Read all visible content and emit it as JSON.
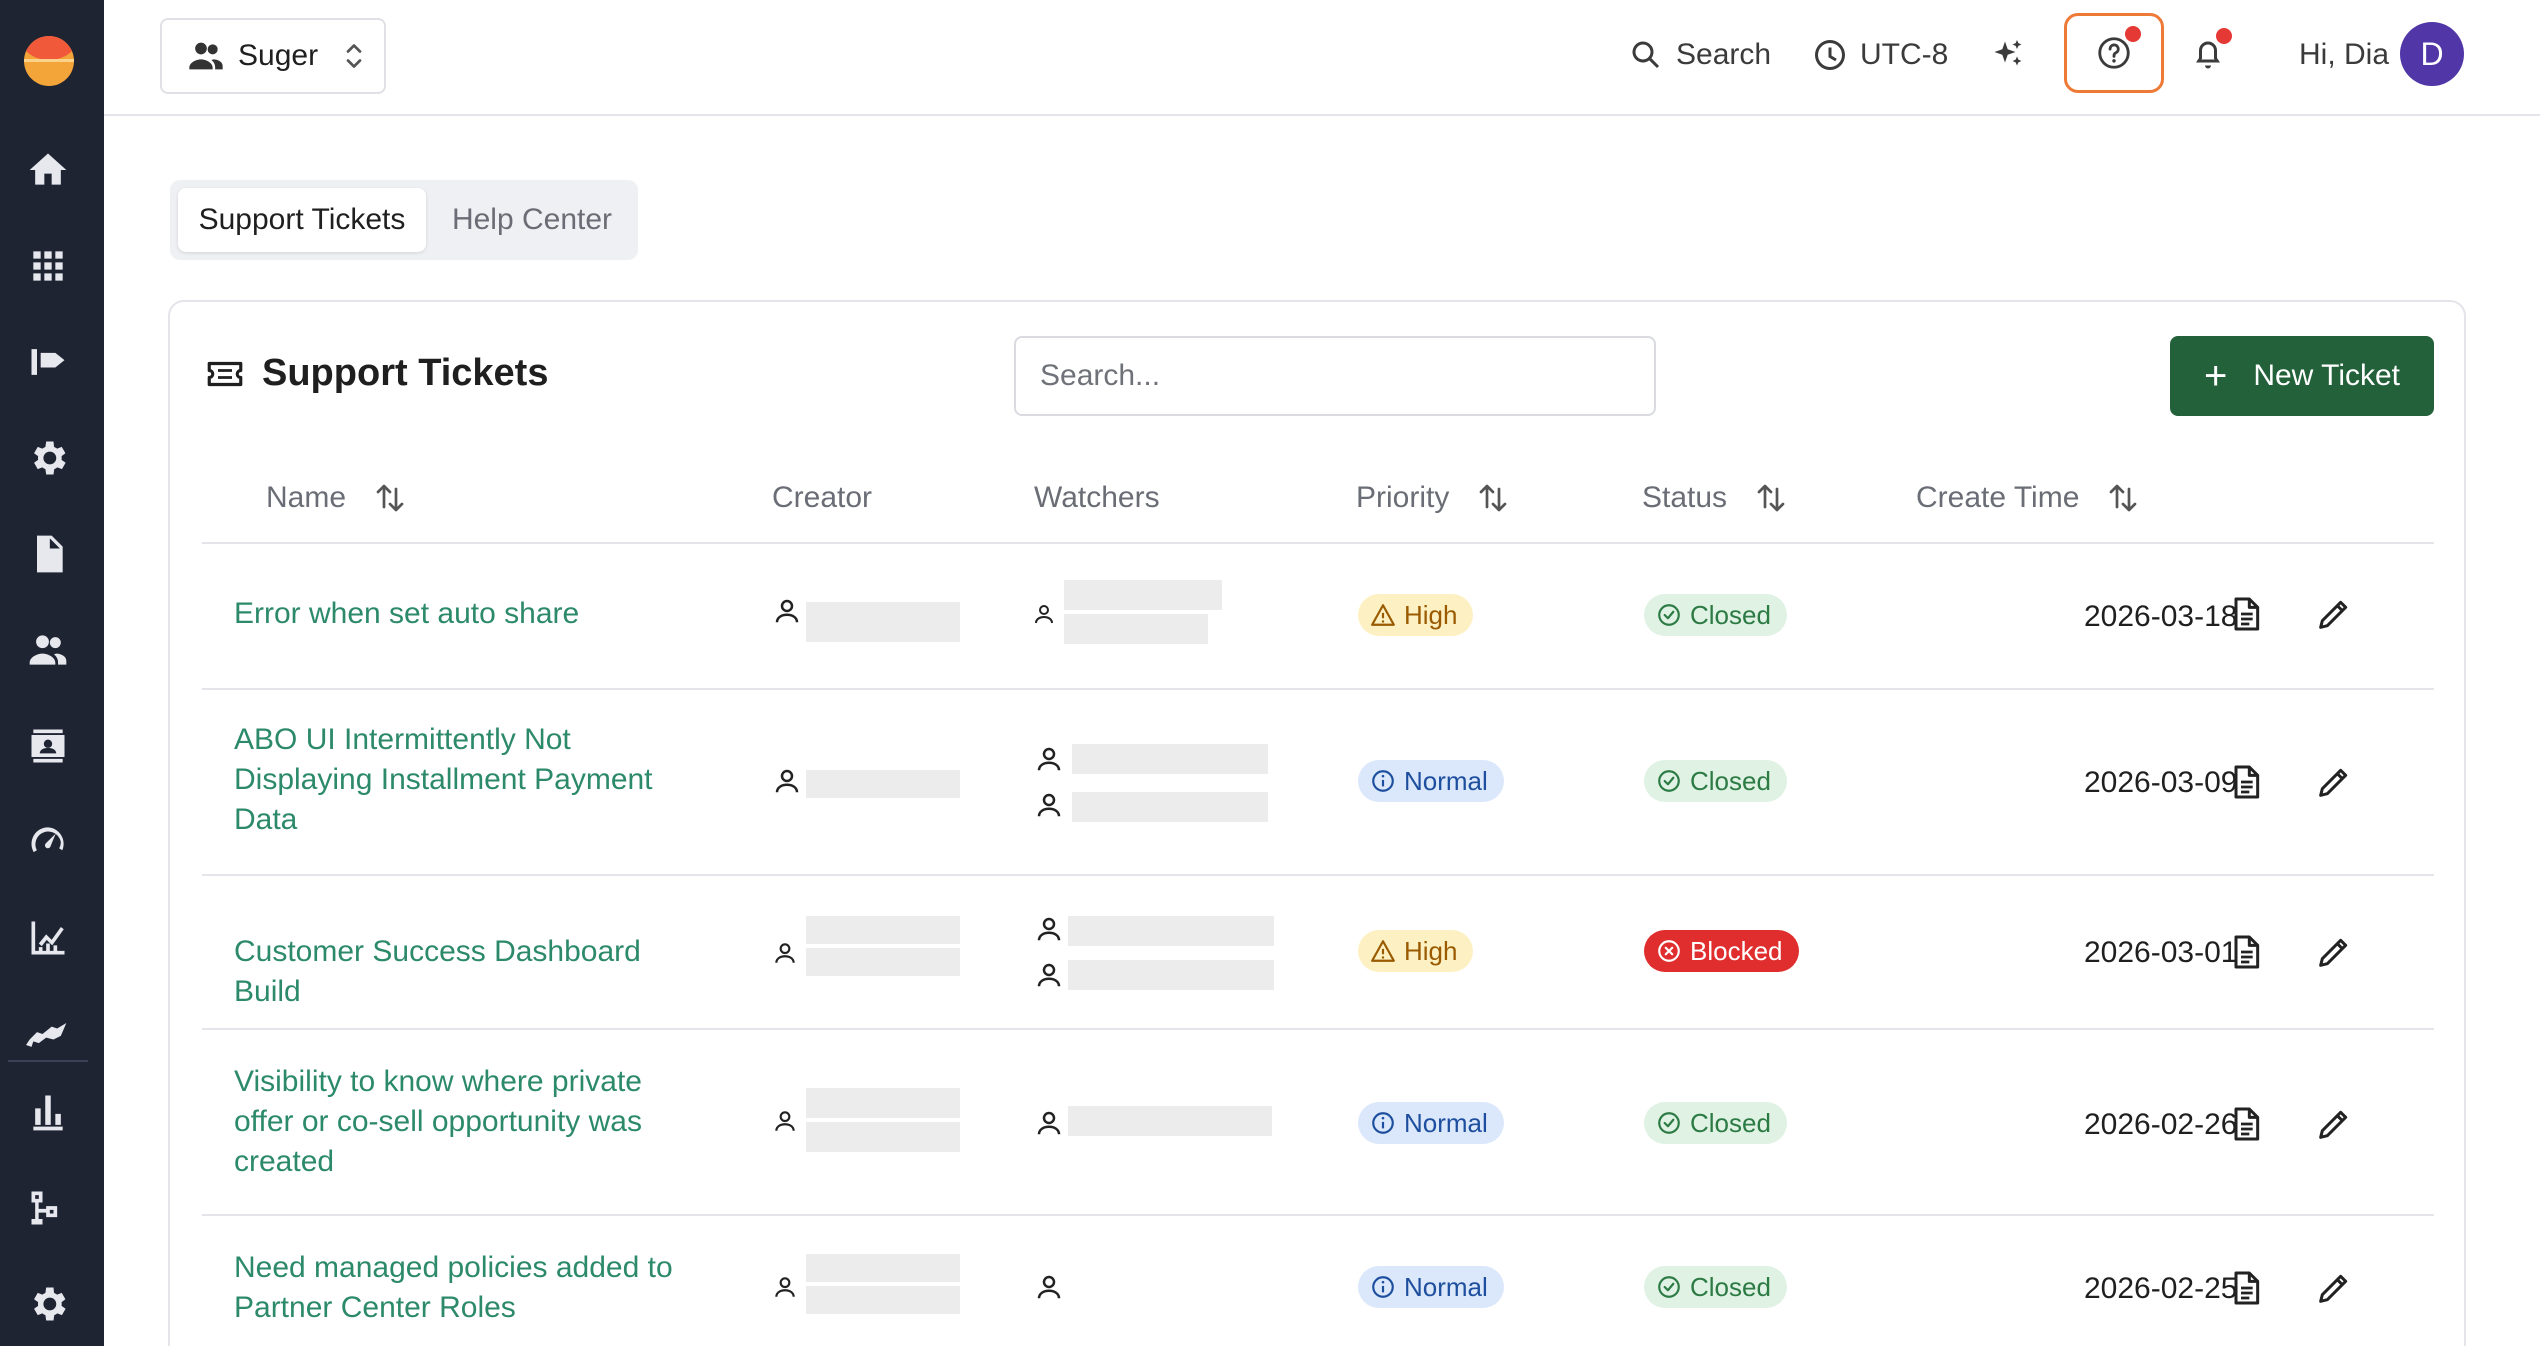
{
  "app": {
    "org_name": "Suger",
    "search_label": "Search",
    "timezone": "UTC-8",
    "greeting": "Hi, Dia",
    "avatar_initial": "D",
    "accent_color": "#23613a",
    "link_color": "#2c8a6a",
    "help_highlight_color": "#ee7a37"
  },
  "sidebar": {
    "items": [
      "home-icon",
      "apps-grid-icon",
      "listing-icon",
      "settings-gear-icon",
      "document-icon",
      "people-icon",
      "contact-card-icon",
      "speedometer-icon",
      "analytics-chart-icon",
      "handshake-icon",
      "bar-chart-icon",
      "workflow-icon",
      "settings-icon"
    ]
  },
  "tabs": [
    {
      "label": "Support Tickets",
      "active": true
    },
    {
      "label": "Help Center",
      "active": false
    }
  ],
  "tickets": {
    "title": "Support Tickets",
    "search_placeholder": "Search...",
    "new_button": "New Ticket",
    "columns": {
      "name": "Name",
      "creator": "Creator",
      "watchers": "Watchers",
      "priority": "Priority",
      "status": "Status",
      "create_time": "Create Time"
    },
    "rows": [
      {
        "name": "Error when set auto share",
        "priority": "High",
        "status": "Closed",
        "created": "2026-03-18"
      },
      {
        "name": "ABO UI Intermittently Not Displaying Installment Payment Data",
        "priority": "Normal",
        "status": "Closed",
        "created": "2026-03-09"
      },
      {
        "name": "Customer Success Dashboard Build",
        "priority": "High",
        "status": "Blocked",
        "created": "2026-03-01"
      },
      {
        "name": "Visibility to know where private offer or co-sell opportunity was created",
        "priority": "Normal",
        "status": "Closed",
        "created": "2026-02-26"
      },
      {
        "name": "Need managed policies added to Partner Center Roles",
        "priority": "Normal",
        "status": "Closed",
        "created": "2026-02-25"
      }
    ]
  }
}
